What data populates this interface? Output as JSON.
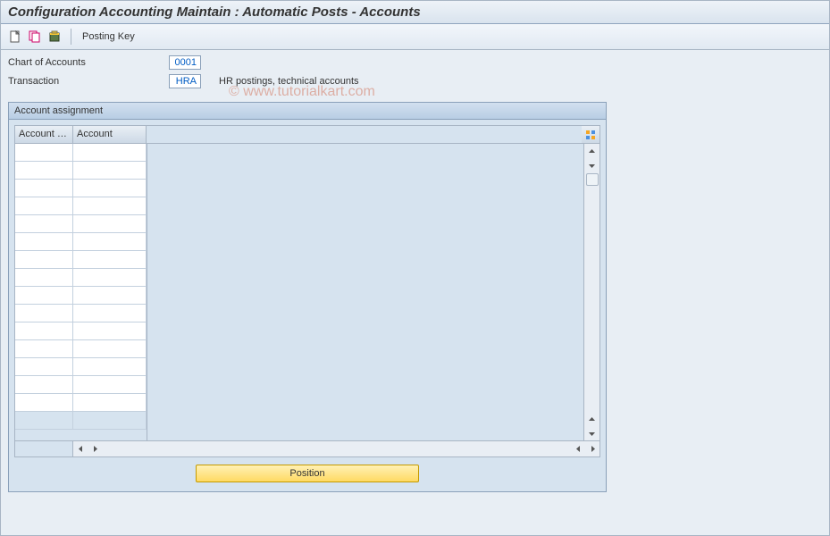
{
  "title": "Configuration Accounting Maintain : Automatic Posts - Accounts",
  "toolbar": {
    "posting_key_label": "Posting Key"
  },
  "info": {
    "coa_label": "Chart of Accounts",
    "coa_value": "0001",
    "txn_label": "Transaction",
    "txn_value": "HRA",
    "txn_desc": "HR postings, technical accounts"
  },
  "panel": {
    "header": "Account assignment",
    "col_a": "Account k...",
    "col_b": "Account",
    "rows": [
      {
        "a": "",
        "b": ""
      },
      {
        "a": "",
        "b": ""
      },
      {
        "a": "",
        "b": ""
      },
      {
        "a": "",
        "b": ""
      },
      {
        "a": "",
        "b": ""
      },
      {
        "a": "",
        "b": ""
      },
      {
        "a": "",
        "b": ""
      },
      {
        "a": "",
        "b": ""
      },
      {
        "a": "",
        "b": ""
      },
      {
        "a": "",
        "b": ""
      },
      {
        "a": "",
        "b": ""
      },
      {
        "a": "",
        "b": ""
      },
      {
        "a": "",
        "b": ""
      },
      {
        "a": "",
        "b": ""
      },
      {
        "a": "",
        "b": ""
      },
      {
        "a": "",
        "b": ""
      }
    ]
  },
  "position_btn": "Position",
  "watermark": "© www.tutorialkart.com"
}
